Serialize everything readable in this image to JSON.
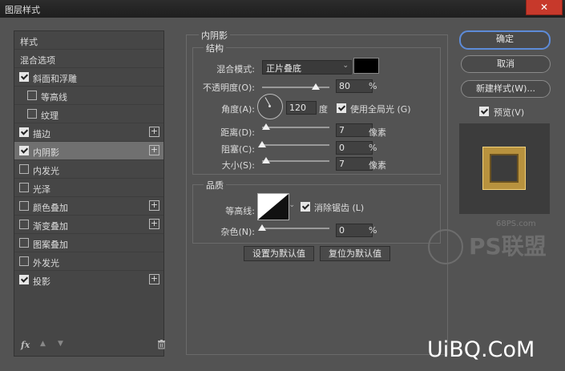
{
  "window": {
    "title": "图层样式",
    "close_label": "✕"
  },
  "sidebar": {
    "items": [
      {
        "label": "样式",
        "checkbox": false
      },
      {
        "label": "混合选项",
        "checkbox": false
      },
      {
        "label": "斜面和浮雕",
        "checkbox": true,
        "checked": true
      },
      {
        "label": "等高线",
        "checkbox": true,
        "checked": false,
        "indent": true
      },
      {
        "label": "纹理",
        "checkbox": true,
        "checked": false,
        "indent": true
      },
      {
        "label": "描边",
        "checkbox": true,
        "checked": true,
        "plus": true
      },
      {
        "label": "内阴影",
        "checkbox": true,
        "checked": true,
        "plus": true,
        "selected": true
      },
      {
        "label": "内发光",
        "checkbox": true,
        "checked": false
      },
      {
        "label": "光泽",
        "checkbox": true,
        "checked": false
      },
      {
        "label": "颜色叠加",
        "checkbox": true,
        "checked": false,
        "plus": true
      },
      {
        "label": "渐变叠加",
        "checkbox": true,
        "checked": false,
        "plus": true
      },
      {
        "label": "图案叠加",
        "checkbox": true,
        "checked": false
      },
      {
        "label": "外发光",
        "checkbox": true,
        "checked": false
      },
      {
        "label": "投影",
        "checkbox": true,
        "checked": true,
        "plus": true
      }
    ],
    "fx_label": "fx",
    "up_icon": "▲",
    "down_icon": "▼",
    "trash_icon": "🗑"
  },
  "inner_shadow": {
    "section_title": "内阴影",
    "structure": {
      "title": "结构",
      "blend_mode_label": "混合模式:",
      "blend_mode_value": "正片叠底",
      "shadow_color": "#000000",
      "opacity_label": "不透明度(O):",
      "opacity_value": "80",
      "opacity_unit": "%",
      "opacity_fraction": 0.8,
      "angle_label": "角度(A):",
      "angle_value": "120",
      "angle_unit": "度",
      "global_light_label": "使用全局光 (G)",
      "distance_label": "距离(D):",
      "distance_value": "7",
      "distance_unit": "像素",
      "choke_label": "阻塞(C):",
      "choke_value": "0",
      "choke_unit": "%",
      "size_label": "大小(S):",
      "size_value": "7",
      "size_unit": "像素"
    },
    "quality": {
      "title": "品质",
      "contour_label": "等高线:",
      "antialias_label": "消除锯齿 (L)",
      "noise_label": "杂色(N):",
      "noise_value": "0",
      "noise_unit": "%"
    },
    "set_default_label": "设置为默认值",
    "reset_default_label": "复位为默认值"
  },
  "right": {
    "ok_label": "确定",
    "cancel_label": "取消",
    "new_style_label": "新建样式(W)...",
    "preview_label": "预览(V)"
  },
  "watermarks": {
    "site": "68PS.com",
    "brand": "PS联盟",
    "corner": "UiBQ.CoM"
  },
  "colors": {
    "accent": "#5d8bd8",
    "gold": "#b8923e"
  }
}
